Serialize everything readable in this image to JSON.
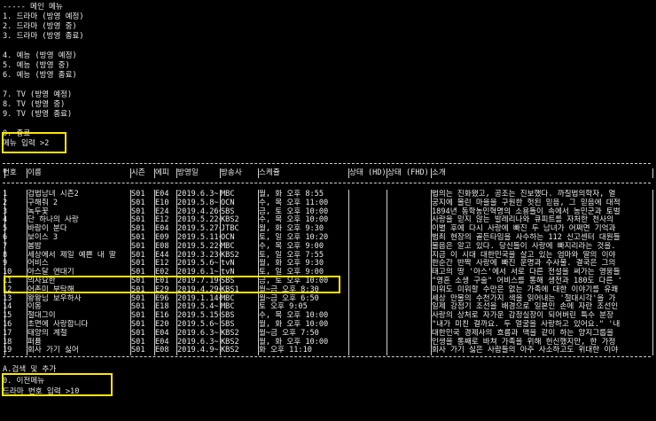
{
  "menu": {
    "header": "----- 메인 메뉴",
    "items": [
      "1. 드라마 (방영 예정)",
      "2. 드라마 (방영 중)",
      "3. 드라마 (방영 종료)",
      "",
      "4. 예능 (방영 예정)",
      "5. 예능 (방영 중)",
      "6. 예능 (방영 종료)",
      "",
      "7. TV (방영 예정)",
      "8. TV (방영 중)",
      "9. TV (방영 종료)",
      "",
      "0. 종료"
    ],
    "prompt": "메뉴 입력 >2"
  },
  "table": {
    "headers": [
      "번호",
      "이름",
      "시즌",
      "에피",
      "방영일",
      "방송사",
      "스케쥴",
      "상태 (HD)",
      "상태 (FHD)",
      "소개"
    ],
    "rows": [
      [
        "1",
        "검법남녀 시즌2",
        "S01",
        "E04",
        "2019.6.3~",
        "MBC",
        "월, 화 오후 8:55",
        "",
        "",
        "법의는 진화됐고, 공조는 진보했다. 까칠법의학자, 열"
      ],
      [
        "2",
        "구해줘 2",
        "S01",
        "E10",
        "2019.5.8~",
        "OCN",
        "수, 목 오후 11:00",
        "",
        "",
        "궁지에 몰린 마을을 구원한 헛된 믿음, 그 믿음에 대적"
      ],
      [
        "3",
        "녹두꽃",
        "S01",
        "E24",
        "2019.4.26~",
        "SBS",
        "금, 토 오후 10:00",
        "",
        "",
        "1894년 동학농민혁명의 소용돌이 속에서 농민군과 토벌"
      ],
      [
        "4",
        "단 하나의 사랑",
        "S01",
        "E12",
        "2019.5.22~",
        "KBS2",
        "수, 목 오후 10:00",
        "",
        "",
        "사랑을 믿지 않는 발레리나와 큐피트를 자처한 천사의"
      ],
      [
        "5",
        "바람이 분다",
        "S01",
        "E04",
        "2019.5.27~",
        "JTBC",
        "월, 화 오후 9:30",
        "",
        "",
        "이별 후에 다시 사랑에 빠진 두 남녀가 어쩌면 기억과"
      ],
      [
        "6",
        "보이스 3",
        "S01",
        "E09",
        "2019.5.11~",
        "OCN",
        "토, 일 오후 10:20",
        "",
        "",
        "범죄 현장의 골든타임을 사수하는 112 신고센터 대원들"
      ],
      [
        "7",
        "봄밤",
        "S01",
        "E08",
        "2019.5.22~",
        "MBC",
        "수, 목 오후 9:00",
        "",
        "",
        "물음은 알고 있다. 당신들이 사랑에 빠지리라는 것을."
      ],
      [
        "8",
        "세상에서 제일 예쁜 내 딸",
        "S01",
        "E44",
        "2019.3.23~",
        "KBS2",
        "토, 일 오후 7:55",
        "",
        "",
        "지금 이 시대 대한민국을 살고 있는 엄마와 딸의 이야"
      ],
      [
        "9",
        "어비스",
        "S01",
        "E12",
        "2019.5.6~",
        "tvN",
        "월, 화 오후 9:30",
        "",
        "",
        "한순간 반짝 사랑에 빠진 운명과 수사물. 결국은 그의"
      ],
      [
        "10",
        "아스달 연대기",
        "S01",
        "E02",
        "2019.6.1~",
        "tvN",
        "토, 일 오후 9:00",
        "",
        "",
        "태고의 땅 '아스'에서 서로 다른 전설을 써가는 영웅들"
      ],
      [
        "11",
        "의사요한",
        "S01",
        "E01",
        "2019.7.19~",
        "SBS",
        "금, 토 오후 10:00",
        "",
        "",
        "\"영혼 소생 구술\" 어비스를 통해 생전과 180도 다른 '"
      ],
      [
        "12",
        "어촌미 부탁해",
        "S01",
        "E29",
        "2019.4.29~",
        "KBS1",
        "월~금 오후 8:30",
        "",
        "",
        "미워도 미워할 수만은 없는 가족에 대한 이야기를 유쾌"
      ],
      [
        "13",
        "왕왕님 보우하사",
        "S01",
        "E96",
        "2019.1.14~",
        "MBC",
        "월~금 오후 6:50",
        "",
        "",
        "세상 만물의 수천가지 색을 읽어내는 '절대시각'을 가"
      ],
      [
        "14",
        "이몽",
        "S01",
        "E18",
        "2019.5.4~",
        "MBC",
        "토 오후 9:05",
        "",
        "",
        "일제 강점기 조선을 배경으로 일본인 손에 자란 조선인"
      ],
      [
        "15",
        "절대그이",
        "S01",
        "E16",
        "2019.5.15~",
        "SBS",
        "수, 목 오후 10:00",
        "",
        "",
        "사랑의 상처로 자가운 감정실장이 되어버린 특수 분장"
      ],
      [
        "16",
        "초면에 사랑합니다",
        "S01",
        "E20",
        "2019.5.6~",
        "SBS",
        "월, 화 오후 10:00",
        "",
        "",
        "\"내가 미친 걸까요. 두 얼굴을 사랑하고 있어요.\" '내"
      ],
      [
        "17",
        "태양의 계절",
        "S01",
        "E04",
        "2019.6.3~",
        "KBS2",
        "월~금 오후 7:50",
        "",
        "",
        "대한민국 경제사의 흐름과 맥을 같이 하는 양지그룹을"
      ],
      [
        "18",
        "퍼퓸",
        "S01",
        "E04",
        "2019.6.3~",
        "KBS2",
        "월, 화 오후 10:00",
        "",
        "",
        "인생을 통째로 바쳐 가족을 위해 헌신했지만, 한 가정"
      ],
      [
        "19",
        "회사 가기 싫어",
        "S01",
        "E08",
        "2019.4.9~",
        "KBS2",
        "화 오후 11:10",
        "",
        "",
        "회사 가기 싫은 사람들의 아주 사소하고도 위대한 이야"
      ]
    ]
  },
  "footer": {
    "search_label": "A.검색 및 추가",
    "back_label": "0. 이전메뉴",
    "prompt": "드라마 번호 입력 >10"
  }
}
